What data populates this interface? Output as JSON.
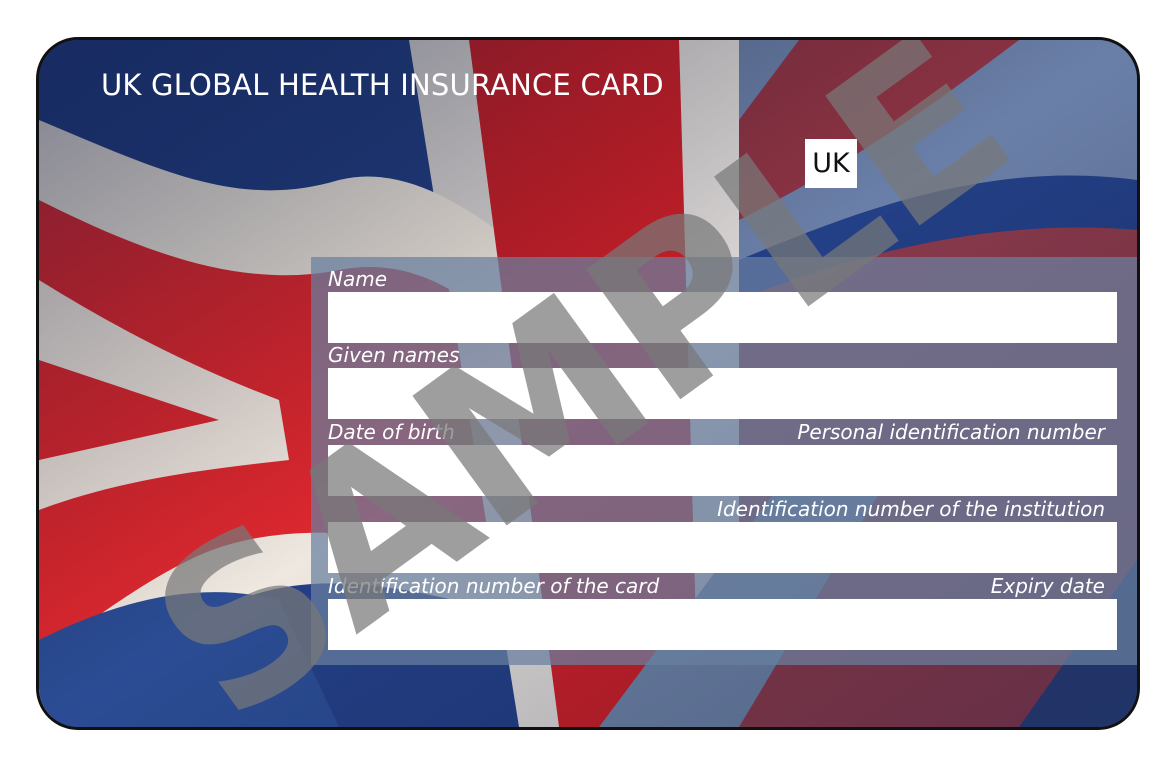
{
  "card": {
    "title": "UK GLOBAL HEALTH INSURANCE CARD",
    "country_code": "UK",
    "watermark": "SAMPLE",
    "fields": {
      "name_label": "Name",
      "given_names_label": "Given names",
      "date_of_birth_label": "Date of birth",
      "personal_id_label": "Personal identification number",
      "institution_id_label": "Identification number of the institution",
      "card_id_label": "Identification number of the card",
      "expiry_label": "Expiry date"
    },
    "colors": {
      "flag_blue": "#233f86",
      "flag_red": "#d9252e",
      "flag_white": "#efe8e0",
      "panel": "#6980a0"
    }
  }
}
